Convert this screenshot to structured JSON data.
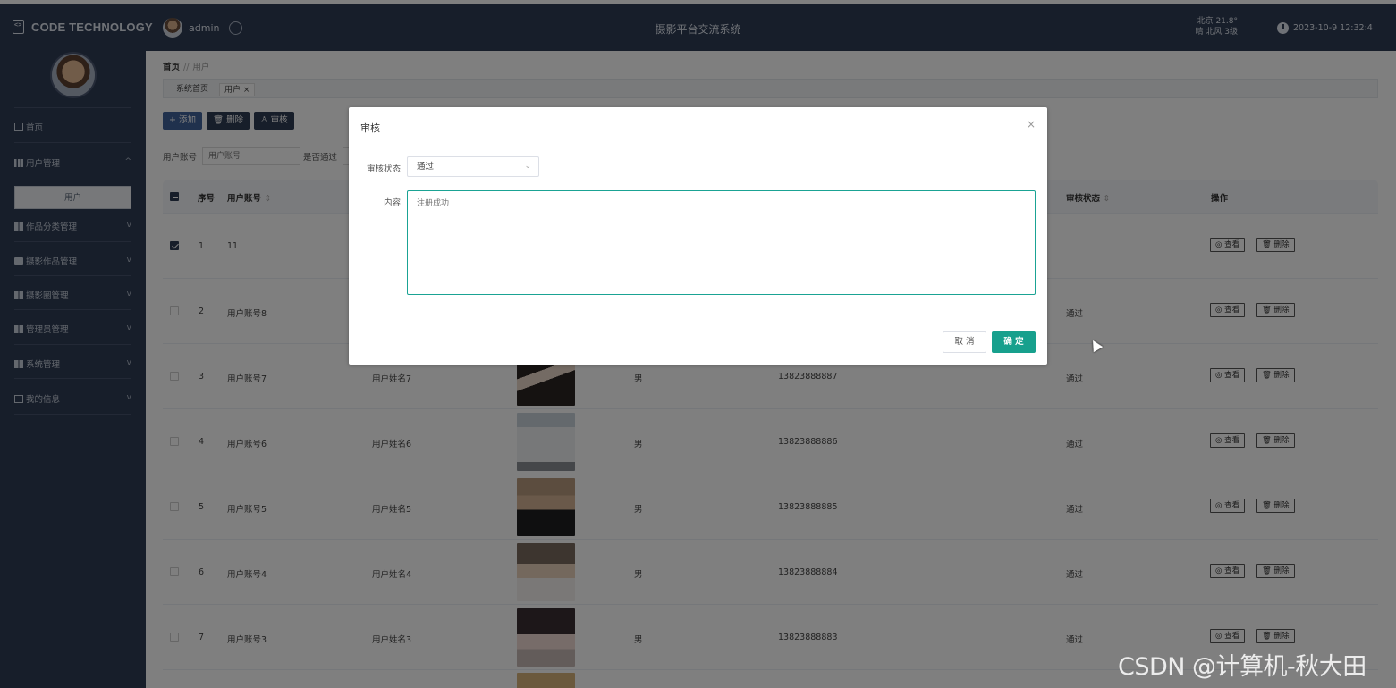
{
  "header": {
    "brand": "CODE TECHNOLOGY",
    "user": "admin",
    "title": "摄影平台交流系统",
    "weather_line1": "北京  21.8°",
    "weather_line2": "晴 北风  3级",
    "datetime": "2023-10-9 12:32:4"
  },
  "sidebar": {
    "items": [
      {
        "label": "首页",
        "icon": "home-icon"
      },
      {
        "label": "用户管理",
        "icon": "bar-chart-icon",
        "chevron": "^"
      },
      {
        "label": "作品分类管理",
        "icon": "grid-icon",
        "chevron": "v"
      },
      {
        "label": "摄影作品管理",
        "icon": "message-icon",
        "chevron": "v"
      },
      {
        "label": "摄影圈管理",
        "icon": "grid-icon",
        "chevron": "v"
      },
      {
        "label": "管理员管理",
        "icon": "grid-icon",
        "chevron": "v"
      },
      {
        "label": "系统管理",
        "icon": "table-icon",
        "chevron": "v"
      },
      {
        "label": "我的信息",
        "icon": "card-icon",
        "chevron": "v"
      }
    ],
    "active_sub": "用户"
  },
  "breadcrumb": {
    "home": "首页",
    "sep": "//",
    "current": "用户"
  },
  "tabs": [
    {
      "label": "系统首页"
    },
    {
      "label": "用户 ×"
    }
  ],
  "toolbar": {
    "add": "+ 添加",
    "delete": "🗑 删除",
    "audit": "♙ 审核"
  },
  "search": {
    "label1": "用户账号",
    "placeholder1": "用户账号",
    "label2": "是否通过"
  },
  "table": {
    "headers": {
      "index": "序号",
      "account": "用户账号",
      "audit": "审核状态",
      "actions": "操作"
    },
    "sort_icon": "⇕",
    "view_label": "◎ 查看",
    "delete_label": "🗑 删除",
    "rows": [
      {
        "index": "1",
        "account": "11",
        "name": "",
        "gender": "",
        "phone": "",
        "status": "",
        "checked": true
      },
      {
        "index": "2",
        "account": "用户账号8",
        "name": "",
        "gender": "",
        "phone": "",
        "status": "通过",
        "checked": false
      },
      {
        "index": "3",
        "account": "用户账号7",
        "name": "用户姓名7",
        "gender": "男",
        "phone": "13823888887",
        "status": "通过",
        "checked": false
      },
      {
        "index": "4",
        "account": "用户账号6",
        "name": "用户姓名6",
        "gender": "男",
        "phone": "13823888886",
        "status": "通过",
        "checked": false
      },
      {
        "index": "5",
        "account": "用户账号5",
        "name": "用户姓名5",
        "gender": "男",
        "phone": "13823888885",
        "status": "通过",
        "checked": false
      },
      {
        "index": "6",
        "account": "用户账号4",
        "name": "用户姓名4",
        "gender": "男",
        "phone": "13823888884",
        "status": "通过",
        "checked": false
      },
      {
        "index": "7",
        "account": "用户账号3",
        "name": "用户姓名3",
        "gender": "男",
        "phone": "13823888883",
        "status": "通过",
        "checked": false
      }
    ]
  },
  "dialog": {
    "title": "审核",
    "close": "×",
    "status_label": "审核状态",
    "status_value": "通过",
    "content_label": "内容",
    "content_placeholder": "注册成功",
    "cancel": "取 消",
    "confirm": "确 定"
  },
  "watermark": "CSDN @计算机-秋大田",
  "colors": {
    "sidebar": "#2f3c55",
    "accent": "#17a08d"
  }
}
